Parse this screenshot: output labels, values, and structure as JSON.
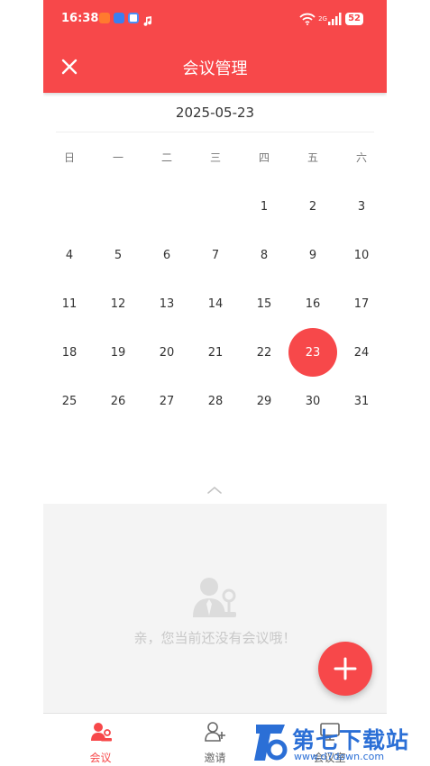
{
  "status_bar": {
    "time": "16:38",
    "signal_label": "2G",
    "battery": "52"
  },
  "header": {
    "title": "会议管理"
  },
  "selected_date": "2025-05-23",
  "weekdays": [
    "日",
    "一",
    "二",
    "三",
    "四",
    "五",
    "六"
  ],
  "calendar": {
    "leading_blank_days": 4,
    "days": [
      "1",
      "2",
      "3",
      "4",
      "5",
      "6",
      "7",
      "8",
      "9",
      "10",
      "11",
      "12",
      "13",
      "14",
      "15",
      "16",
      "17",
      "18",
      "19",
      "20",
      "21",
      "22",
      "23",
      "24",
      "25",
      "26",
      "27",
      "28",
      "29",
      "30",
      "31"
    ],
    "selected_day": "23"
  },
  "empty_state": {
    "message": "亲，您当前还没有会议哦！",
    "icon": "meeting-person-icon"
  },
  "bottom_nav": {
    "items": [
      {
        "label": "会议",
        "icon": "meeting-icon",
        "active": true
      },
      {
        "label": "邀请",
        "icon": "invite-icon",
        "active": false
      },
      {
        "label": "会议室",
        "icon": "meeting-room-icon",
        "active": false
      }
    ]
  },
  "watermark": {
    "text": "第七下载站",
    "url": "www.d7down.com"
  },
  "colors": {
    "primary": "#f7484a",
    "empty_bg": "#f4f4f4",
    "watermark": "#2b6fd6"
  }
}
